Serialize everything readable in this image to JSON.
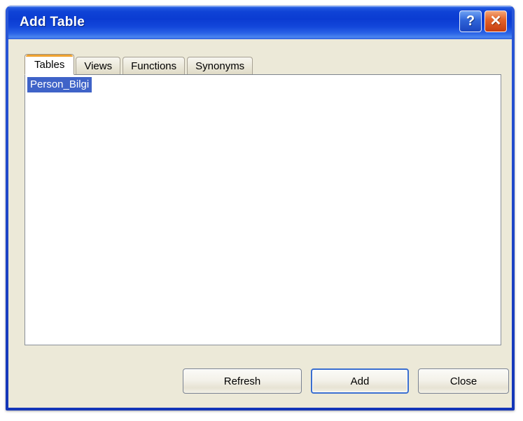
{
  "window": {
    "title": "Add Table",
    "help_button": "?",
    "close_button": "✕",
    "icons": {
      "help": "help-question-icon",
      "close": "close-x-icon"
    }
  },
  "tabs": [
    {
      "label": "Tables",
      "active": true
    },
    {
      "label": "Views",
      "active": false
    },
    {
      "label": "Functions",
      "active": false
    },
    {
      "label": "Synonyms",
      "active": false
    }
  ],
  "list": {
    "items": [
      {
        "label": "Person_Bilgi",
        "selected": true
      }
    ]
  },
  "buttons": {
    "refresh": "Refresh",
    "add": "Add",
    "close": "Close"
  },
  "colors": {
    "titlebar_blue": "#0b3cd2",
    "frame_blue": "#1d41c4",
    "body_beige": "#ece9d8",
    "selection_blue": "#3f63c8",
    "active_tab_accent": "#f0a330",
    "default_button_border": "#3a6ecf",
    "close_button_orange": "#e4642a"
  }
}
